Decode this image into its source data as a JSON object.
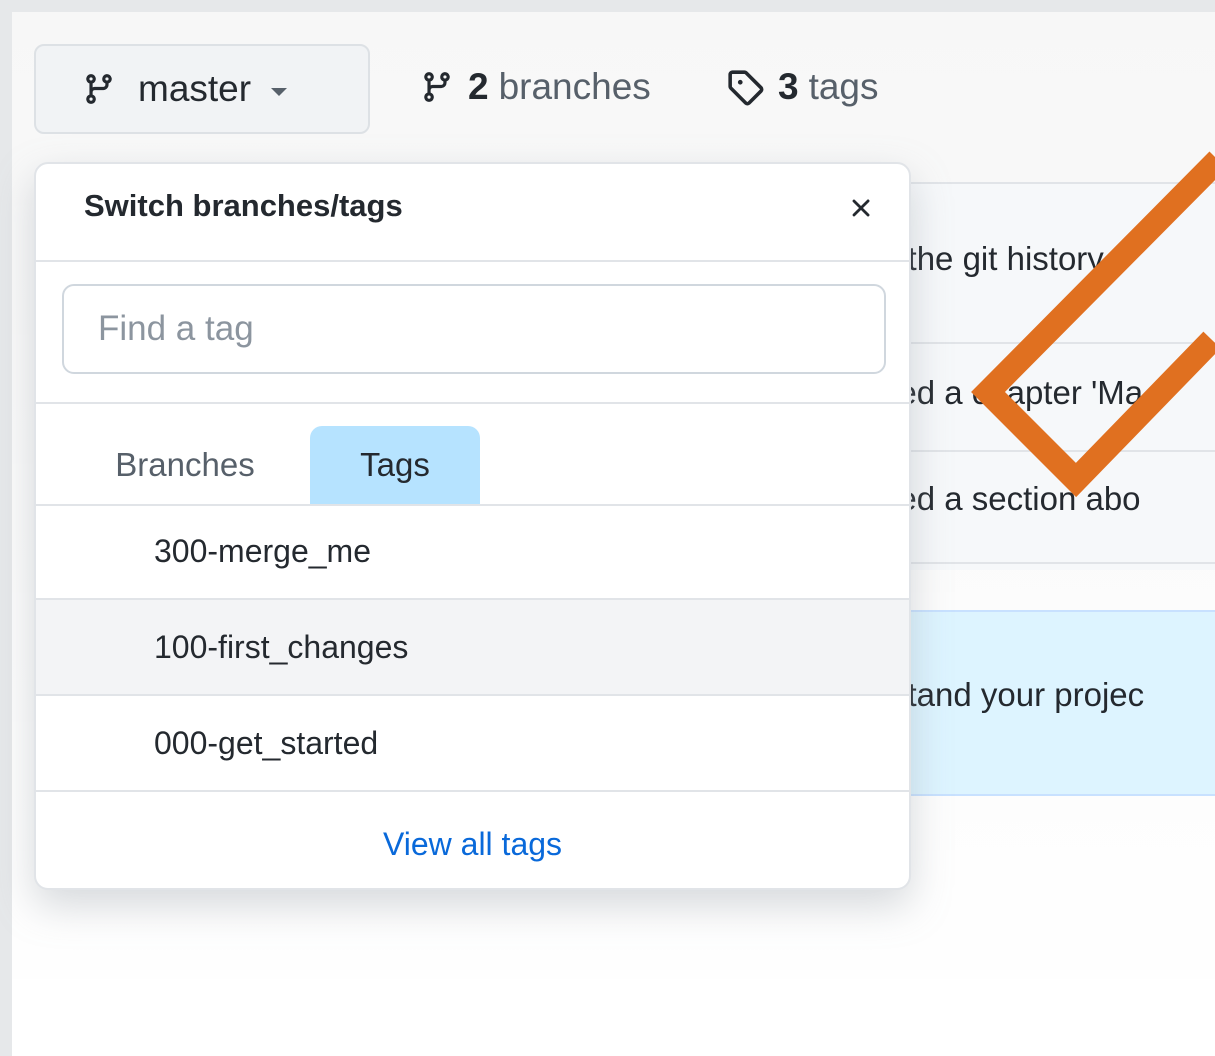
{
  "toolbar": {
    "branch_button_label": "master",
    "branches_count": "2",
    "branches_word": "branches",
    "tags_count": "3",
    "tags_word": "tags"
  },
  "background": {
    "row1": "n the git history",
    "row2": "ded a chapter 'Ma",
    "row3": "ded a section abo",
    "notice": "rstand your projec"
  },
  "dropdown": {
    "title": "Switch branches/tags",
    "filter_placeholder": "Find a tag",
    "tabs": [
      {
        "label": "Branches",
        "selected": false
      },
      {
        "label": "Tags",
        "selected": true
      }
    ],
    "tags": [
      {
        "name": "300-merge_me"
      },
      {
        "name": "100-first_changes",
        "highlighted": true
      },
      {
        "name": "000-get_started"
      }
    ],
    "footer_link": "View all tags"
  },
  "icons": {
    "branch": "git-branch-icon",
    "tag": "tag-icon",
    "close": "close-icon",
    "caret": "caret-down-icon"
  },
  "colors": {
    "accent_link": "#0969da",
    "selected_tab": "#b6e3ff",
    "annotation": "#e07020"
  }
}
